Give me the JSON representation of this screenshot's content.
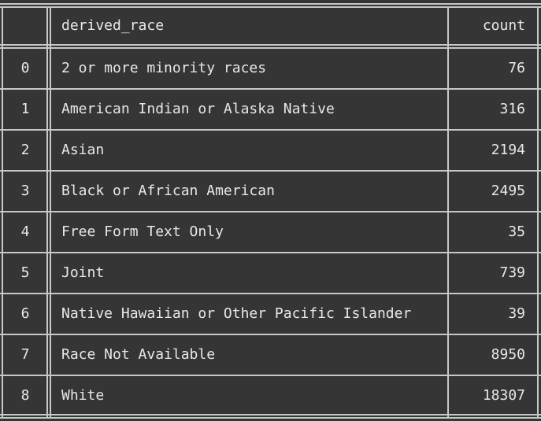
{
  "table": {
    "columns": {
      "index": "",
      "name": "derived_race",
      "count": "count"
    },
    "rows": [
      {
        "index": "0",
        "name": "2 or more minority races",
        "count": "76"
      },
      {
        "index": "1",
        "name": "American Indian or Alaska Native",
        "count": "316"
      },
      {
        "index": "2",
        "name": "Asian",
        "count": "2194"
      },
      {
        "index": "3",
        "name": "Black or African American",
        "count": "2495"
      },
      {
        "index": "4",
        "name": "Free Form Text Only",
        "count": "35"
      },
      {
        "index": "5",
        "name": "Joint",
        "count": "739"
      },
      {
        "index": "6",
        "name": "Native Hawaiian or Other Pacific Islander",
        "count": "39"
      },
      {
        "index": "7",
        "name": "Race Not Available",
        "count": "8950"
      },
      {
        "index": "8",
        "name": "White",
        "count": "18307"
      }
    ]
  },
  "colors": {
    "background": "#353535",
    "text": "#e8e8e8",
    "rule": "#c8c8c8"
  }
}
